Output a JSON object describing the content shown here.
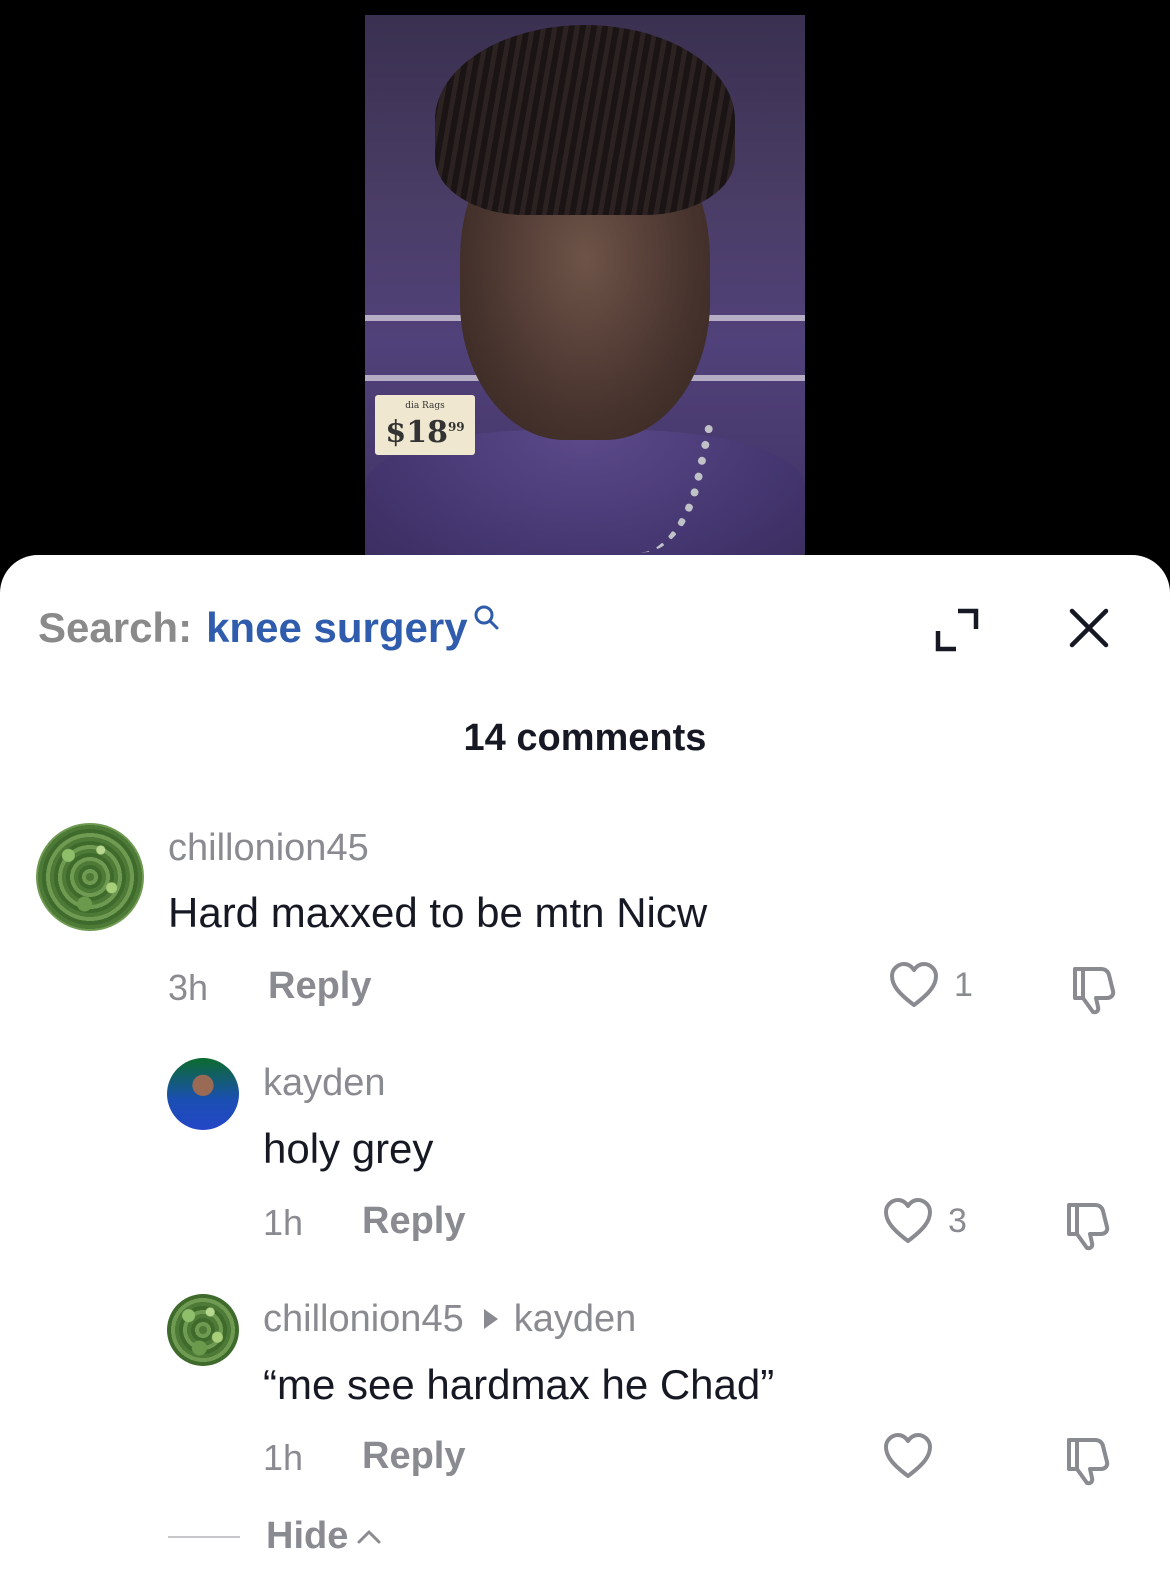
{
  "video": {
    "price_small": "dia Rags",
    "price_dollar": "$18",
    "price_cents": "99"
  },
  "search": {
    "label": "Search:",
    "term": "knee surgery"
  },
  "comments_header": "14 comments",
  "comments": [
    {
      "username": "chillonion45",
      "text": "Hard maxxed to be mtn Nicw",
      "time": "3h",
      "reply_label": "Reply",
      "likes": "1"
    },
    {
      "username": "kayden",
      "text": "holy grey",
      "time": "1h",
      "reply_label": "Reply",
      "likes": "3"
    },
    {
      "username": "chillonion45",
      "reply_to": "kayden",
      "text": "“me see hardmax he Chad”",
      "time": "1h",
      "reply_label": "Reply",
      "likes": ""
    }
  ],
  "hide_label": "Hide",
  "icons": {
    "search": "search-icon",
    "expand": "expand-icon",
    "close": "close-icon",
    "like": "heart-icon",
    "dislike": "thumbs-down-icon",
    "hide": "chevron-up-icon"
  },
  "colors": {
    "search_term": "#2f5cad",
    "secondary_text": "#8a8b91",
    "primary_text": "#161823"
  }
}
